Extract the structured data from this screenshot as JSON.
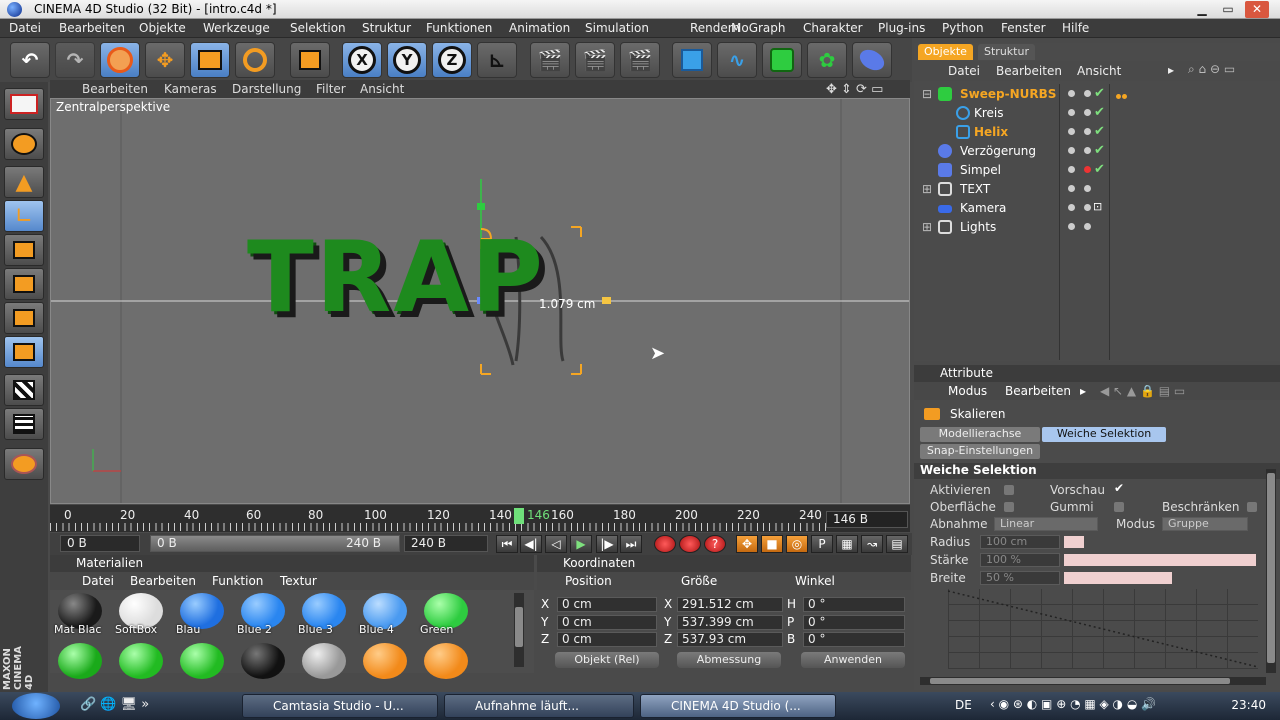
{
  "window": {
    "title": "CINEMA 4D Studio (32 Bit) - [intro.c4d *]"
  },
  "menu": [
    "Datei",
    "Bearbeiten",
    "Objekte",
    "Werkzeuge",
    "Selektion",
    "Struktur",
    "Funktionen",
    "Animation",
    "Simulation",
    "Rendern",
    "MoGraph",
    "Charakter",
    "Plug-ins",
    "Python",
    "Fenster",
    "Hilfe"
  ],
  "toolbar": {
    "axis_x": "X",
    "axis_y": "Y",
    "axis_z": "Z"
  },
  "viewport": {
    "menu": [
      "Bearbeiten",
      "Kameras",
      "Darstellung",
      "Filter",
      "Ansicht"
    ],
    "label": "Zentralperspektive",
    "text3d": "TRAP",
    "measure": "1.079 cm"
  },
  "timeline": {
    "ticks": [
      "0",
      "20",
      "40",
      "60",
      "80",
      "100",
      "120",
      "140",
      "160",
      "180",
      "200",
      "220",
      "240"
    ],
    "current": "146",
    "frame_field": "146 B",
    "start_field": "0 B",
    "range_start": "0 B",
    "range_end": "240 B",
    "end_field": "240 B"
  },
  "materials": {
    "title": "Materialien",
    "menu": [
      "Datei",
      "Bearbeiten",
      "Funktion",
      "Textur"
    ],
    "items": [
      {
        "name": "Mat Blac",
        "color": "#1a1a1a"
      },
      {
        "name": "SoftBox",
        "color": "#f4f4f4"
      },
      {
        "name": "Blau",
        "color": "#1f6fe0"
      },
      {
        "name": "Blue 2",
        "color": "#2a86f0"
      },
      {
        "name": "Blue 3",
        "color": "#2a86f0"
      },
      {
        "name": "Blue 4",
        "color": "#4a9af0"
      },
      {
        "name": "Green",
        "color": "#2ecc40"
      }
    ],
    "items_row2": [
      "#1aaa1a",
      "#22bb22",
      "#22bb22",
      "#111111",
      "#bbbbbb",
      "#f28a1a",
      "#f28a1a"
    ]
  },
  "coords": {
    "title": "Koordinaten",
    "col_position": "Position",
    "col_size": "Größe",
    "col_angle": "Winkel",
    "rows": [
      {
        "axis": "X",
        "pos": "0 cm",
        "saxis": "X",
        "size": "291.512 cm",
        "aaxis": "H",
        "angle": "0 °"
      },
      {
        "axis": "Y",
        "pos": "0 cm",
        "saxis": "Y",
        "size": "537.399 cm",
        "aaxis": "P",
        "angle": "0 °"
      },
      {
        "axis": "Z",
        "pos": "0 cm",
        "saxis": "Z",
        "size": "537.93 cm",
        "aaxis": "B",
        "angle": "0 °"
      }
    ],
    "btn_object": "Objekt (Rel)",
    "btn_size": "Abmessung",
    "btn_apply": "Anwenden"
  },
  "objects": {
    "tab_objects": "Objekte",
    "tab_structure": "Struktur",
    "menu": [
      "Datei",
      "Bearbeiten",
      "Ansicht"
    ],
    "items": [
      {
        "name": "Sweep-NURBS",
        "color": "#f5a623",
        "icon": "sweep-nurbs-icon"
      },
      {
        "name": "Kreis",
        "color": "#ffffff",
        "icon": "circle-spline-icon"
      },
      {
        "name": "Helix",
        "color": "#f5a623",
        "icon": "helix-spline-icon"
      },
      {
        "name": "Verzögerung",
        "color": "#ffffff",
        "icon": "delay-effector-icon"
      },
      {
        "name": "Simpel",
        "color": "#ffffff",
        "icon": "simple-effector-icon"
      },
      {
        "name": "TEXT",
        "color": "#ffffff",
        "icon": "null-object-icon"
      },
      {
        "name": "Kamera",
        "color": "#ffffff",
        "icon": "camera-icon"
      },
      {
        "name": "Lights",
        "color": "#ffffff",
        "icon": "null-object-icon"
      }
    ]
  },
  "attributes": {
    "title": "Attribute",
    "menu": [
      "Modus",
      "Bearbeiten"
    ],
    "tool": "Skalieren",
    "tab_model_axis": "Modellierachse",
    "tab_soft": "Weiche Selektion",
    "tab_snap": "Snap-Einstellungen",
    "section": "Weiche Selektion",
    "activate": "Aktivieren",
    "preview": "Vorschau",
    "surface": "Oberfläche",
    "rubber": "Gummi",
    "restrict": "Beschränken",
    "falloff": "Abnahme",
    "falloff_value": "Linear",
    "mode": "Modus",
    "mode_value": "Gruppe",
    "radius": "Radius",
    "radius_value": "100 cm",
    "strength": "Stärke",
    "strength_value": "100 %",
    "width": "Breite",
    "width_value": "50 %"
  },
  "taskbar": {
    "items": [
      "Camtasia Studio - U...",
      "Aufnahme läuft...",
      "CINEMA 4D Studio (..."
    ],
    "lang": "DE",
    "time": "23:40"
  },
  "brand": "MAXON CINEMA 4D"
}
